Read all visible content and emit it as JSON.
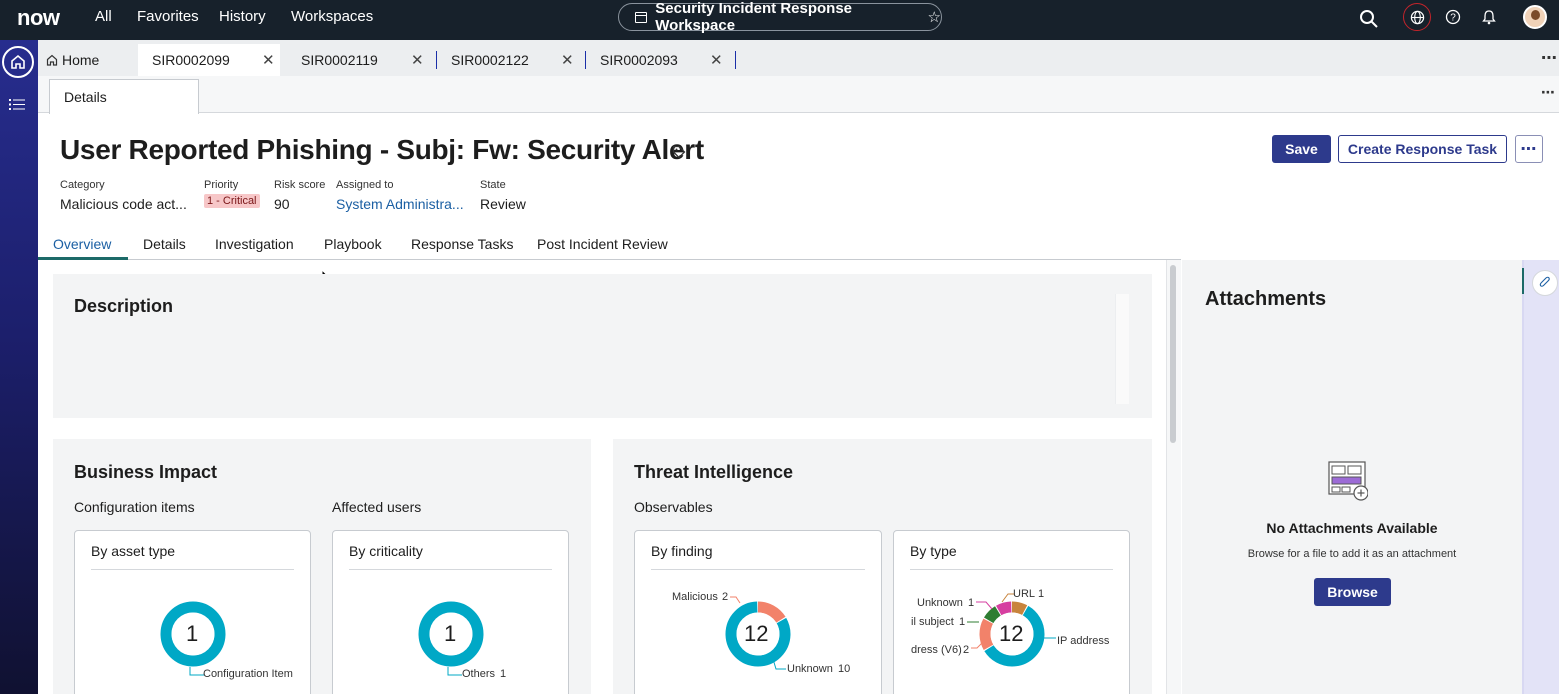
{
  "header": {
    "logo": "now",
    "nav": [
      "All",
      "Favorites",
      "History",
      "Workspaces"
    ],
    "workspace_title": "Security Incident Response Workspace",
    "icons": [
      "search-icon",
      "globe-icon",
      "help-icon",
      "bell-icon",
      "avatar"
    ],
    "colors": {
      "bar": "#17212b",
      "globe_ring": "#c2242b"
    }
  },
  "rail": {
    "items": [
      "home-icon",
      "list-icon"
    ]
  },
  "tabs": {
    "home_label": "Home",
    "items": [
      {
        "label": "SIR0002099",
        "active": true
      },
      {
        "label": "SIR0002119",
        "active": false
      },
      {
        "label": "SIR0002122",
        "active": false
      },
      {
        "label": "SIR0002093",
        "active": false
      }
    ]
  },
  "subtab": {
    "label": "Details"
  },
  "record": {
    "title": "User Reported Phishing - Subj: Fw: Security Alert",
    "meta": {
      "category_label": "Category",
      "category_value": "Malicious code act...",
      "priority_label": "Priority",
      "priority_value": "1 - Critical",
      "risk_label": "Risk score",
      "risk_value": "90",
      "assigned_label": "Assigned to",
      "assigned_value": "System Administra...",
      "state_label": "State",
      "state_value": "Review"
    },
    "buttons": {
      "save": "Save",
      "create_task": "Create Response Task"
    },
    "tabs": [
      "Overview",
      "Details",
      "Investigation",
      "Playbook",
      "Response Tasks",
      "Post Incident Review"
    ],
    "active_tab": "Overview"
  },
  "description": {
    "title": "Description"
  },
  "business_impact": {
    "title": "Business Impact",
    "config_items_label": "Configuration items",
    "affected_users_label": "Affected users",
    "card1_title": "By asset type",
    "card2_title": "By criticality"
  },
  "threat_intel": {
    "title": "Threat Intelligence",
    "observables_label": "Observables",
    "card1_title": "By finding",
    "card2_title": "By type"
  },
  "chart_data": [
    {
      "type": "pie",
      "title": "By asset type",
      "center_label": "1",
      "series": [
        {
          "name": "Configuration Item",
          "value": 1,
          "color": "#00a8c6"
        }
      ]
    },
    {
      "type": "pie",
      "title": "By criticality",
      "center_label": "1",
      "series": [
        {
          "name": "Others",
          "value": 1,
          "color": "#00a8c6"
        }
      ]
    },
    {
      "type": "pie",
      "title": "By finding",
      "center_label": "12",
      "series": [
        {
          "name": "Malicious",
          "value": 2,
          "color": "#f2826a"
        },
        {
          "name": "Unknown",
          "value": 10,
          "color": "#00a8c6"
        }
      ]
    },
    {
      "type": "pie",
      "title": "By type",
      "center_label": "12",
      "series": [
        {
          "name": "URL",
          "value": 1,
          "color": "#c8843c"
        },
        {
          "name": "IP address (",
          "value": 7,
          "color": "#00a8c6"
        },
        {
          "name": "dress (V6)",
          "value": 2,
          "color": "#f2826a"
        },
        {
          "name": "il subject",
          "value": 1,
          "color": "#2f7d32"
        },
        {
          "name": "Unknown",
          "value": 1,
          "color": "#d63fa0"
        }
      ]
    }
  ],
  "attachments": {
    "title": "Attachments",
    "empty_title": "No Attachments Available",
    "empty_subtitle": "Browse for a file to add it as an attachment",
    "browse_label": "Browse"
  }
}
